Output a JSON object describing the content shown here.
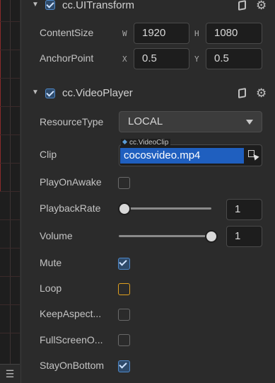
{
  "transform": {
    "title": "cc.UITransform",
    "enabled": true,
    "content_size_label": "ContentSize",
    "width_tag": "W",
    "width_value": "1920",
    "height_tag": "H",
    "height_value": "1080",
    "anchor_point_label": "AnchorPoint",
    "anchor_x_tag": "X",
    "anchor_x_value": "0.5",
    "anchor_y_tag": "Y",
    "anchor_y_value": "0.5"
  },
  "video_player": {
    "title": "cc.VideoPlayer",
    "enabled": true,
    "resource_type_label": "ResourceType",
    "resource_type_value": "LOCAL",
    "clip_label": "Clip",
    "clip_asset_type": "cc.VideoClip",
    "clip_value": "cocosvideo.mp4",
    "play_on_awake_label": "PlayOnAwake",
    "play_on_awake": false,
    "playback_rate_label": "PlaybackRate",
    "playback_rate_value": "1",
    "playback_rate_level": 0.0,
    "volume_label": "Volume",
    "volume_value": "1",
    "volume_level": 1.0,
    "mute_label": "Mute",
    "mute": true,
    "loop_label": "Loop",
    "loop": false,
    "keep_aspect_label": "KeepAspect...",
    "keep_aspect": false,
    "full_screen_label": "FullScreenO...",
    "full_screen": false,
    "stay_on_bottom_label": "StayOnBottom",
    "stay_on_bottom": true
  },
  "icons": {
    "collapse": "chevron-down-icon",
    "help": "book-icon",
    "settings": "gear-icon",
    "menu": "menu-icon",
    "asset_picker": "asset-locate-icon"
  },
  "menu_glyph": "☰",
  "colors": {
    "panel_background": "#2b2b2b",
    "accent_blue": "#1f5fbf",
    "focus_orange": "#e0a020"
  }
}
